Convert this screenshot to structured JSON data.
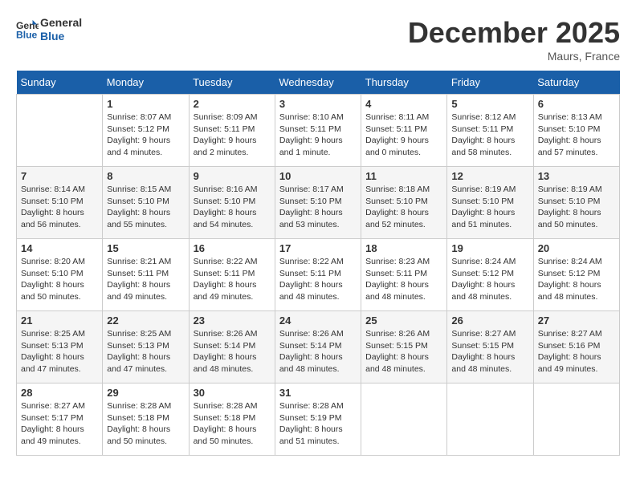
{
  "logo": {
    "line1": "General",
    "line2": "Blue"
  },
  "title": "December 2025",
  "location": "Maurs, France",
  "days_of_week": [
    "Sunday",
    "Monday",
    "Tuesday",
    "Wednesday",
    "Thursday",
    "Friday",
    "Saturday"
  ],
  "weeks": [
    [
      {
        "day": "",
        "info": ""
      },
      {
        "day": "1",
        "info": "Sunrise: 8:07 AM\nSunset: 5:12 PM\nDaylight: 9 hours\nand 4 minutes."
      },
      {
        "day": "2",
        "info": "Sunrise: 8:09 AM\nSunset: 5:11 PM\nDaylight: 9 hours\nand 2 minutes."
      },
      {
        "day": "3",
        "info": "Sunrise: 8:10 AM\nSunset: 5:11 PM\nDaylight: 9 hours\nand 1 minute."
      },
      {
        "day": "4",
        "info": "Sunrise: 8:11 AM\nSunset: 5:11 PM\nDaylight: 9 hours\nand 0 minutes."
      },
      {
        "day": "5",
        "info": "Sunrise: 8:12 AM\nSunset: 5:11 PM\nDaylight: 8 hours\nand 58 minutes."
      },
      {
        "day": "6",
        "info": "Sunrise: 8:13 AM\nSunset: 5:10 PM\nDaylight: 8 hours\nand 57 minutes."
      }
    ],
    [
      {
        "day": "7",
        "info": "Sunrise: 8:14 AM\nSunset: 5:10 PM\nDaylight: 8 hours\nand 56 minutes."
      },
      {
        "day": "8",
        "info": "Sunrise: 8:15 AM\nSunset: 5:10 PM\nDaylight: 8 hours\nand 55 minutes."
      },
      {
        "day": "9",
        "info": "Sunrise: 8:16 AM\nSunset: 5:10 PM\nDaylight: 8 hours\nand 54 minutes."
      },
      {
        "day": "10",
        "info": "Sunrise: 8:17 AM\nSunset: 5:10 PM\nDaylight: 8 hours\nand 53 minutes."
      },
      {
        "day": "11",
        "info": "Sunrise: 8:18 AM\nSunset: 5:10 PM\nDaylight: 8 hours\nand 52 minutes."
      },
      {
        "day": "12",
        "info": "Sunrise: 8:19 AM\nSunset: 5:10 PM\nDaylight: 8 hours\nand 51 minutes."
      },
      {
        "day": "13",
        "info": "Sunrise: 8:19 AM\nSunset: 5:10 PM\nDaylight: 8 hours\nand 50 minutes."
      }
    ],
    [
      {
        "day": "14",
        "info": "Sunrise: 8:20 AM\nSunset: 5:10 PM\nDaylight: 8 hours\nand 50 minutes."
      },
      {
        "day": "15",
        "info": "Sunrise: 8:21 AM\nSunset: 5:11 PM\nDaylight: 8 hours\nand 49 minutes."
      },
      {
        "day": "16",
        "info": "Sunrise: 8:22 AM\nSunset: 5:11 PM\nDaylight: 8 hours\nand 49 minutes."
      },
      {
        "day": "17",
        "info": "Sunrise: 8:22 AM\nSunset: 5:11 PM\nDaylight: 8 hours\nand 48 minutes."
      },
      {
        "day": "18",
        "info": "Sunrise: 8:23 AM\nSunset: 5:11 PM\nDaylight: 8 hours\nand 48 minutes."
      },
      {
        "day": "19",
        "info": "Sunrise: 8:24 AM\nSunset: 5:12 PM\nDaylight: 8 hours\nand 48 minutes."
      },
      {
        "day": "20",
        "info": "Sunrise: 8:24 AM\nSunset: 5:12 PM\nDaylight: 8 hours\nand 48 minutes."
      }
    ],
    [
      {
        "day": "21",
        "info": "Sunrise: 8:25 AM\nSunset: 5:13 PM\nDaylight: 8 hours\nand 47 minutes."
      },
      {
        "day": "22",
        "info": "Sunrise: 8:25 AM\nSunset: 5:13 PM\nDaylight: 8 hours\nand 47 minutes."
      },
      {
        "day": "23",
        "info": "Sunrise: 8:26 AM\nSunset: 5:14 PM\nDaylight: 8 hours\nand 48 minutes."
      },
      {
        "day": "24",
        "info": "Sunrise: 8:26 AM\nSunset: 5:14 PM\nDaylight: 8 hours\nand 48 minutes."
      },
      {
        "day": "25",
        "info": "Sunrise: 8:26 AM\nSunset: 5:15 PM\nDaylight: 8 hours\nand 48 minutes."
      },
      {
        "day": "26",
        "info": "Sunrise: 8:27 AM\nSunset: 5:15 PM\nDaylight: 8 hours\nand 48 minutes."
      },
      {
        "day": "27",
        "info": "Sunrise: 8:27 AM\nSunset: 5:16 PM\nDaylight: 8 hours\nand 49 minutes."
      }
    ],
    [
      {
        "day": "28",
        "info": "Sunrise: 8:27 AM\nSunset: 5:17 PM\nDaylight: 8 hours\nand 49 minutes."
      },
      {
        "day": "29",
        "info": "Sunrise: 8:28 AM\nSunset: 5:18 PM\nDaylight: 8 hours\nand 50 minutes."
      },
      {
        "day": "30",
        "info": "Sunrise: 8:28 AM\nSunset: 5:18 PM\nDaylight: 8 hours\nand 50 minutes."
      },
      {
        "day": "31",
        "info": "Sunrise: 8:28 AM\nSunset: 5:19 PM\nDaylight: 8 hours\nand 51 minutes."
      },
      {
        "day": "",
        "info": ""
      },
      {
        "day": "",
        "info": ""
      },
      {
        "day": "",
        "info": ""
      }
    ]
  ]
}
